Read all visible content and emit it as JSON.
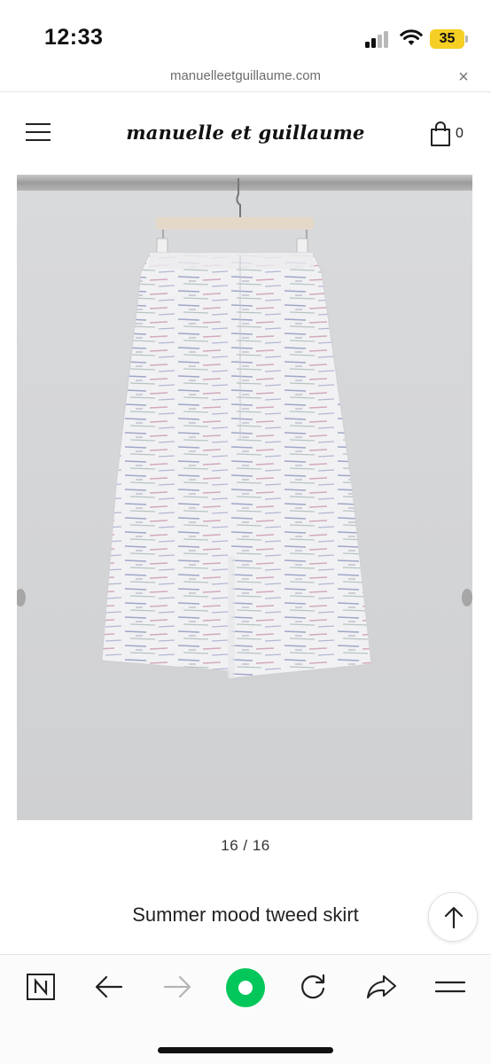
{
  "status_bar": {
    "time": "12:33",
    "battery_level": "35",
    "icons": [
      "cellular-signal-icon",
      "wifi-icon",
      "battery-icon"
    ]
  },
  "url_bar": {
    "url": "manuelleetguillaume.com",
    "close_glyph": "×"
  },
  "site_header": {
    "brand": "manuelle et guillaume",
    "cart_count": "0",
    "icons": [
      "hamburger-menu-icon",
      "shopping-bag-icon"
    ]
  },
  "product": {
    "image_counter": "16 / 16",
    "title": "Summer mood tweed skirt"
  },
  "toolbar": {
    "icons": [
      "naver-home-icon",
      "back-arrow-icon",
      "forward-arrow-icon",
      "green-dot-icon",
      "refresh-icon",
      "share-icon",
      "menu-icon"
    ],
    "accent_color": "#03c75a"
  },
  "colors": {
    "battery": "#f5cf24",
    "image_background": "#d5d6d8"
  }
}
